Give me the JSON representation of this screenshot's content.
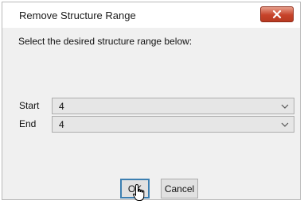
{
  "dialog": {
    "title": "Remove Structure Range",
    "prompt": "Select the desired structure range below:",
    "start": {
      "label": "Start",
      "value": "4"
    },
    "end": {
      "label": "End",
      "value": "4"
    },
    "ok_label": "OK",
    "cancel_label": "Cancel"
  },
  "icons": {
    "close": "close-icon",
    "dropdown": "chevron-down-icon",
    "cursor": "hand-pointer-cursor"
  },
  "colors": {
    "close_button": "#c7432a",
    "ok_focus_border": "#3c7fb1",
    "dialog_bg": "#f0f0f0"
  }
}
